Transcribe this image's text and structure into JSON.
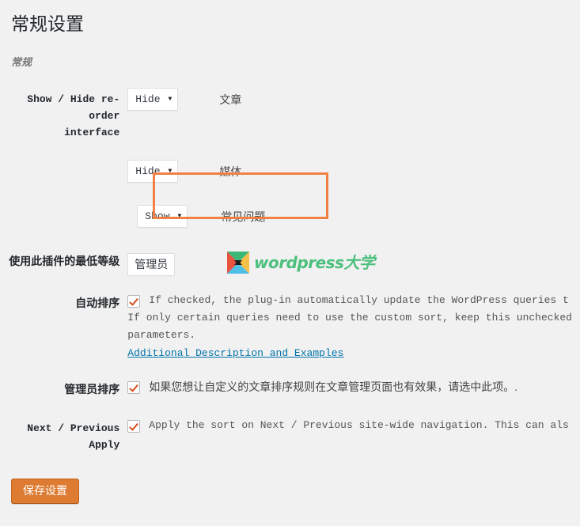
{
  "page": {
    "title": "常规设置",
    "section_heading": "常规"
  },
  "rows": {
    "reorder": {
      "label_line1": "Show / Hide re-order",
      "label_line2": "interface",
      "items": [
        {
          "value": "Hide",
          "caret": "chevron-down-icon",
          "object_label": "文章",
          "highlighted": false
        },
        {
          "value": "Hide",
          "caret": "chevron-down-icon",
          "object_label": "媒体",
          "highlighted": false
        },
        {
          "value": "Show",
          "caret": "chevron-down-icon",
          "object_label": "常见问题",
          "highlighted": true
        }
      ]
    },
    "min_level": {
      "label": "使用此插件的最低等级",
      "value": "管理员"
    },
    "auto_sort": {
      "label": "自动排序",
      "checked": true,
      "desc_line1": "If checked, the plug-in automatically update the WordPress queries t",
      "desc_line2": "If only certain queries need to use the custom sort, keep this unchecked",
      "desc_line3": "parameters.",
      "link_text": "Additional Description and Examples"
    },
    "admin_sort": {
      "label": "管理员排序",
      "checked": true,
      "desc": "如果您想让自定义的文章排序规则在文章管理页面也有效果，请选中此项。."
    },
    "next_prev": {
      "label": "Next / Previous Apply",
      "checked": true,
      "desc": "Apply the sort on Next / Previous site-wide navigation. This can als"
    }
  },
  "watermark": {
    "text": "wordpress大学",
    "mark": "butterfly-logo-icon"
  },
  "submit": {
    "label": "保存设置"
  },
  "colors": {
    "highlight": "#f28044",
    "accent_button": "#dd7b32",
    "link": "#0073aa",
    "checkmark": "#d54e21",
    "logo_green": "#4bbf7c",
    "background": "#f1f1f1"
  }
}
